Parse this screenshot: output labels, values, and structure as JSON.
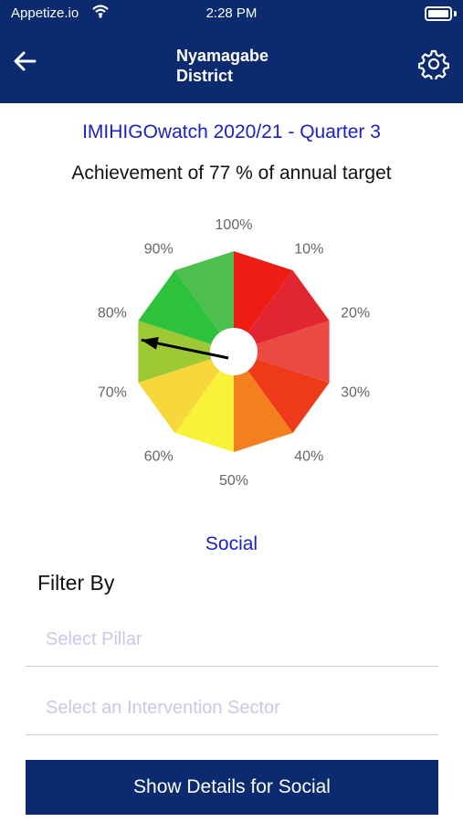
{
  "status_bar": {
    "carrier": "Appetize.io",
    "time": "2:28 PM",
    "wifi_icon": "wifi-icon",
    "battery_icon": "battery-icon"
  },
  "header": {
    "title_line1": "Nyamagabe",
    "title_line2": "District",
    "back_icon": "arrow-left-icon",
    "settings_icon": "gear-icon",
    "background": "#0b2a6f"
  },
  "report": {
    "title": "IMIHIGOwatch 2020/21 - Quarter 3",
    "achievement_text": "Achievement of 77 % of annual target",
    "achievement_value": 77
  },
  "gauge": {
    "labels": [
      "100%",
      "10%",
      "20%",
      "30%",
      "40%",
      "50%",
      "60%",
      "70%",
      "80%",
      "90%"
    ],
    "segment_colors": [
      "#ee1c12",
      "#e12531",
      "#eb4a43",
      "#ee3a18",
      "#f47f1f",
      "#f8f339",
      "#f8d73d",
      "#9dca34",
      "#2ec23c",
      "#4cbf4e"
    ],
    "needle_value": 77
  },
  "pillar": {
    "name": "Social"
  },
  "filters": {
    "label": "Filter By",
    "pillar_placeholder": "Select Pillar",
    "sector_placeholder": "Select an Intervention Sector"
  },
  "action": {
    "button_label": "Show Details for Social"
  }
}
